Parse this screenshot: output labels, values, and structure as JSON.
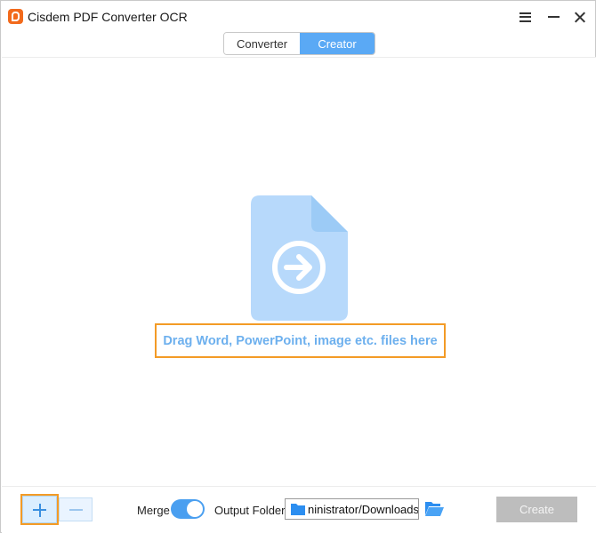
{
  "window": {
    "title": "Cisdem PDF Converter OCR",
    "controls": {
      "menu_icon": "hamburger-menu-icon",
      "minimize_icon": "minimize-icon",
      "close_icon": "close-icon"
    }
  },
  "tabs": [
    {
      "label": "Converter",
      "active": false
    },
    {
      "label": "Creator",
      "active": true
    }
  ],
  "drop_zone": {
    "icon": "file-arrow-icon",
    "text": "Drag Word, PowerPoint, image etc. files here"
  },
  "bottom_bar": {
    "add_icon": "plus-icon",
    "remove_icon": "minus-icon",
    "merge_label": "Merge",
    "merge_enabled": true,
    "output_folder_label": "Output Folder",
    "output_folder_value": "ninistrator/Downloads",
    "browse_icon": "open-folder-icon",
    "create_label": "Create"
  },
  "colors": {
    "accent": "#5aa9f5",
    "highlight_border": "#f39b26",
    "drop_text": "#6db0ee",
    "create_disabled": "#bdbdbd"
  }
}
